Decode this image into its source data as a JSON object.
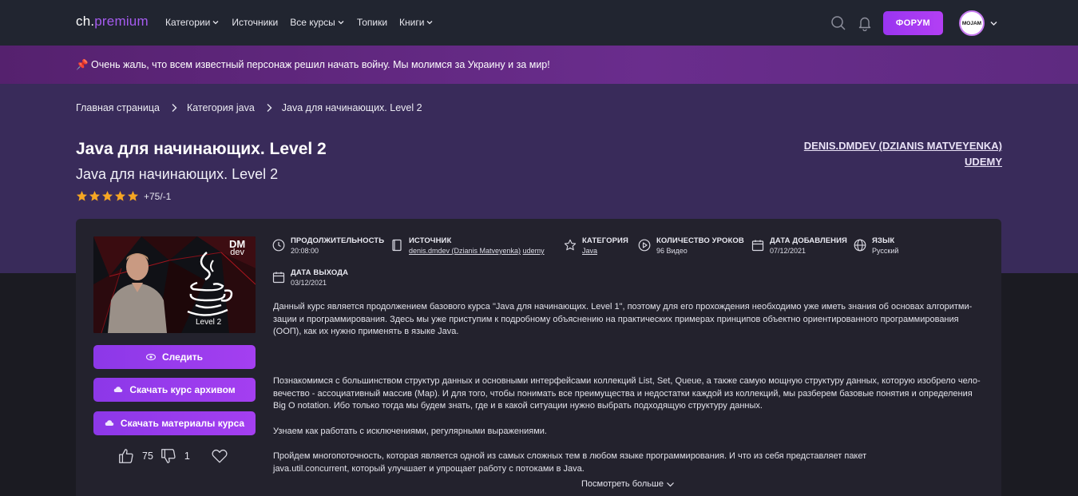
{
  "nav": {
    "logo_part1": "ch.",
    "logo_part2": "premium",
    "menu": [
      {
        "label": "Категории",
        "dropdown": true
      },
      {
        "label": "Источники",
        "dropdown": false
      },
      {
        "label": "Все курсы",
        "dropdown": true
      },
      {
        "label": "Топики",
        "dropdown": false
      },
      {
        "label": "Книги",
        "dropdown": true
      }
    ],
    "forum_label": "ФОРУМ",
    "avatar_text": "MOJAM"
  },
  "banner": {
    "text": "📌 Очень жаль, что всем известный персонаж решил начать войну. Мы молимся за Украину и за мир!"
  },
  "breadcrumb": [
    "Главная страница",
    "Категория java",
    "Java для начинающих. Level 2"
  ],
  "course": {
    "title": "Java для начинающих. Level 2",
    "subtitle": "Java для начинающих. Level 2",
    "rating_stars": 5,
    "rating_text": "+75/-1",
    "author_link": "DENIS.DMDEV (DZIANIS MATVEYENKA)",
    "source_link": "UDEMY"
  },
  "thumbnail": {
    "brand_top": "DM",
    "brand_bottom": "dev",
    "caption": "Level 2"
  },
  "actions": {
    "follow": "Следить",
    "download_archive": "Скачать курс архивом",
    "download_materials": "Скачать материалы курса",
    "likes": "75",
    "dislikes": "1"
  },
  "meta": {
    "duration_label": "ПРОДОЛЖИТЕЛЬНОСТЬ",
    "duration_value": "20:08:00",
    "source_label": "ИСТОЧНИК",
    "source_value_1": "denis.dmdev (Dzianis Matveyenka)",
    "source_value_2": "udemy",
    "category_label": "КАТЕГОРИЯ",
    "category_value": "Java",
    "lessons_label": "КОЛИЧЕСТВО УРОКОВ",
    "lessons_value": "96 Видео",
    "added_label": "ДАТА ДОБАВЛЕНИЯ",
    "added_value": "07/12/2021",
    "language_label": "ЯЗЫК",
    "language_value": "Русский",
    "release_label": "ДАТА ВЫХОДА",
    "release_value": "03/12/2021"
  },
  "description": {
    "p1_l1": "Данный курс является продолжением базового курса \"Java для начинающих. Level 1\", поэтому для его прохождения необходимо уже иметь знания об основах алгоритми-",
    "p1_l2": "зации и программирования. Здесь мы уже приступим к подробному объяснению на практических примерах принципов объектно ориентированного программирования",
    "p1_l3": "(ООП), как их нужно применять в языке Java.",
    "p2_l1": "Познакомимся с большинством структур данных и основными интерфейсами коллекций List, Set, Queue, а также самую мощную структуру данных, которую изобрело чело-",
    "p2_l2": "вечество - ассоциативный массив (Map). И для того, чтобы понимать все преимущества и недостатки каждой из коллекций, мы разберем базовые понятия и определения",
    "p2_l3": "Big O notation. Ибо только тогда мы будем знать, где и в какой ситуации нужно выбрать подходящую структуру данных.",
    "p3": "Узнаем как работать с исключениями, регулярными выражениями.",
    "p4_l1": "Пройдем многопоточность, которая является одной из самых сложных тем в любом языке программирования. И что из себя представляет пакет",
    "p4_l2": "java.util.concurrent, который улучшает и упрощает работу с потоками в Java.",
    "show_more": "Посмотреть больше"
  },
  "colors": {
    "accent": "#a43ff0",
    "hero_bg": "#392b5a",
    "banner_bg": "#5e2a80",
    "nav_bg": "#212530",
    "star": "#f5a623"
  }
}
